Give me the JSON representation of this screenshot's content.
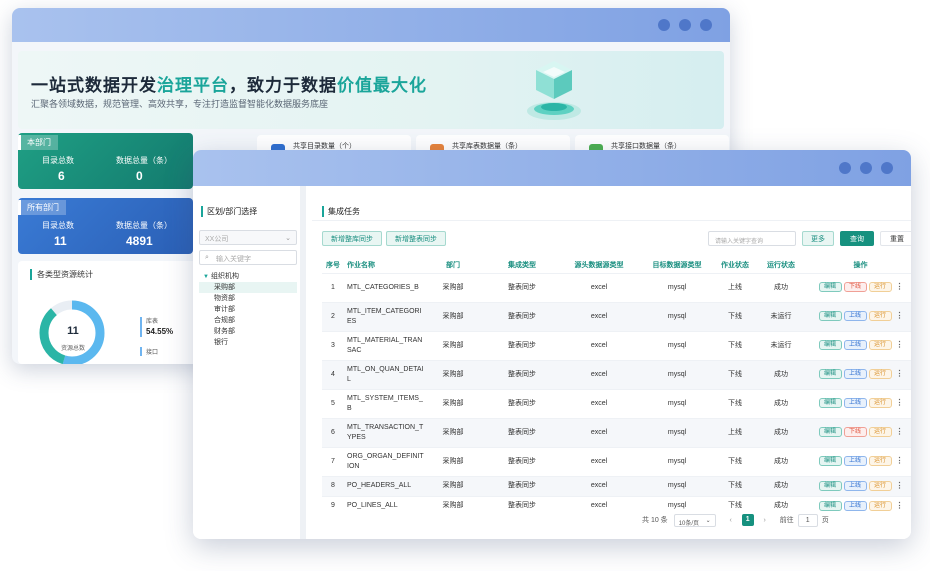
{
  "back": {
    "banner": {
      "title_part1": "一站式数据开发",
      "title_hl1": "治理平台",
      "title_part2": "，致力于数据",
      "title_hl2": "价值最大化",
      "subtitle": "汇聚各领域数据，规范管理、高效共享，专注打造监督智能化数据服务底座"
    },
    "dept_card": {
      "tag": "本部门",
      "label1": "目录总数",
      "value1": "6",
      "label2": "数据总量（条）",
      "value2": "0"
    },
    "all_card": {
      "tag": "所有部门",
      "label1": "目录总数",
      "value1": "11",
      "label2": "数据总量（条）",
      "value2": "4891"
    },
    "type_panel": {
      "title": "各类型资源统计",
      "donut_value": "11",
      "donut_label": "资源总数",
      "legend1_label": "库表",
      "legend1_value": "54.55%",
      "legend2_label": "接口"
    },
    "share_cards": [
      {
        "label": "共享目录数量（个）",
        "color": "#2f6fd0"
      },
      {
        "label": "共享库表数据量（条）",
        "color": "#e8833a"
      },
      {
        "label": "共享接口数据量（条）",
        "color": "#4caf50"
      }
    ]
  },
  "front": {
    "left_panel": {
      "title": "区划/部门选择",
      "company_select": "XX公司",
      "search_placeholder": "输入关键字",
      "tree_root": "组织机构",
      "tree_nodes": [
        "采购部",
        "物资部",
        "审计部",
        "合规部",
        "财务部",
        "银行"
      ]
    },
    "right_panel": {
      "title": "集成任务",
      "btn_add_db": "新增整库同步",
      "btn_add_table": "新增整表同步",
      "keyword_placeholder": "请输入关键字查询",
      "btn_more": "更多",
      "btn_search": "查询",
      "btn_reset": "重置",
      "columns": [
        "序号",
        "作业名称",
        "部门",
        "集成类型",
        "源头数据源类型",
        "目标数据源类型",
        "作业状态",
        "运行状态",
        "操作"
      ],
      "actions": {
        "edit": "编辑",
        "online": "上线",
        "offline": "下线",
        "run": "运行"
      },
      "rows": [
        {
          "no": "1",
          "name": "MTL_CATEGORIES_B",
          "dept": "采购部",
          "type": "整表同步",
          "src": "excel",
          "dst": "mysql",
          "job": "上线",
          "run": "成功",
          "toggle": "下线"
        },
        {
          "no": "2",
          "name": "MTL_ITEM_CATEGORIES",
          "dept": "采购部",
          "type": "整表同步",
          "src": "excel",
          "dst": "mysql",
          "job": "下线",
          "run": "未运行",
          "toggle": "上线"
        },
        {
          "no": "3",
          "name": "MTL_MATERIAL_TRANSAC",
          "dept": "采购部",
          "type": "整表同步",
          "src": "excel",
          "dst": "mysql",
          "job": "下线",
          "run": "未运行",
          "toggle": "上线"
        },
        {
          "no": "4",
          "name": "MTL_ON_QUAN_DETAIL",
          "dept": "采购部",
          "type": "整表同步",
          "src": "excel",
          "dst": "mysql",
          "job": "下线",
          "run": "成功",
          "toggle": "上线"
        },
        {
          "no": "5",
          "name": "MTL_SYSTEM_ITEMS_B",
          "dept": "采购部",
          "type": "整表同步",
          "src": "excel",
          "dst": "mysql",
          "job": "下线",
          "run": "成功",
          "toggle": "上线"
        },
        {
          "no": "6",
          "name": "MTL_TRANSACTION_TYPES",
          "dept": "采购部",
          "type": "整表同步",
          "src": "excel",
          "dst": "mysql",
          "job": "上线",
          "run": "成功",
          "toggle": "下线"
        },
        {
          "no": "7",
          "name": "ORG_ORGAN_DEFINITION",
          "dept": "采购部",
          "type": "整表同步",
          "src": "excel",
          "dst": "mysql",
          "job": "下线",
          "run": "成功",
          "toggle": "上线"
        },
        {
          "no": "8",
          "name": "PO_HEADERS_ALL",
          "dept": "采购部",
          "type": "整表同步",
          "src": "excel",
          "dst": "mysql",
          "job": "下线",
          "run": "成功",
          "toggle": "上线"
        },
        {
          "no": "9",
          "name": "PO_LINES_ALL",
          "dept": "采购部",
          "type": "整表同步",
          "src": "excel",
          "dst": "mysql",
          "job": "下线",
          "run": "成功",
          "toggle": "上线"
        }
      ]
    },
    "pager": {
      "total": "共 10 条",
      "page_size": "10条/页",
      "current": "1",
      "goto_label": "前往",
      "goto_value": "1",
      "page_suffix": "页"
    }
  }
}
